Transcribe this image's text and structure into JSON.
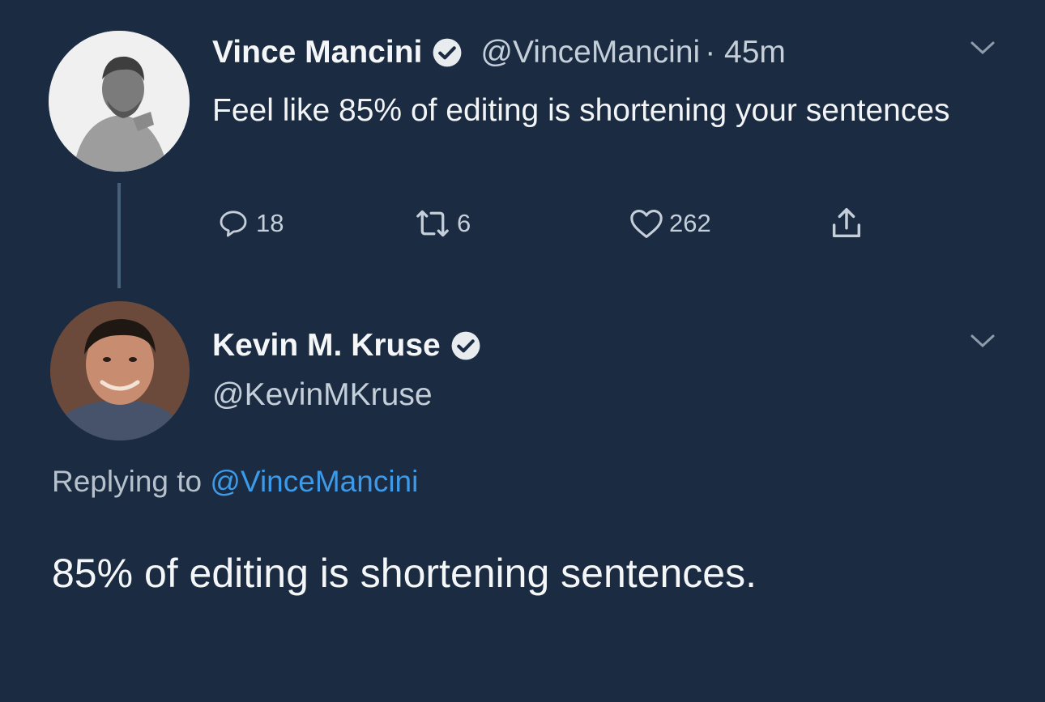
{
  "tweet1": {
    "name": "Vince Mancini",
    "handle": "@VinceMancini",
    "time": "· 45m",
    "text": "Feel like 85% of editing is shortening your sentences",
    "replies": "18",
    "retweets": "6",
    "likes": "262"
  },
  "tweet2": {
    "name": "Kevin M. Kruse",
    "handle": "@KevinMKruse",
    "replying_prefix": "Replying to",
    "replying_to": "@VinceMancini",
    "text": "85% of editing is shortening sentences."
  },
  "colors": {
    "background": "#1a2b42",
    "link": "#3d9ae8",
    "secondary_text": "#c5cfd9"
  },
  "icons": [
    "verified-icon",
    "chevron-down-icon",
    "reply-icon",
    "retweet-icon",
    "heart-icon",
    "share-icon"
  ]
}
